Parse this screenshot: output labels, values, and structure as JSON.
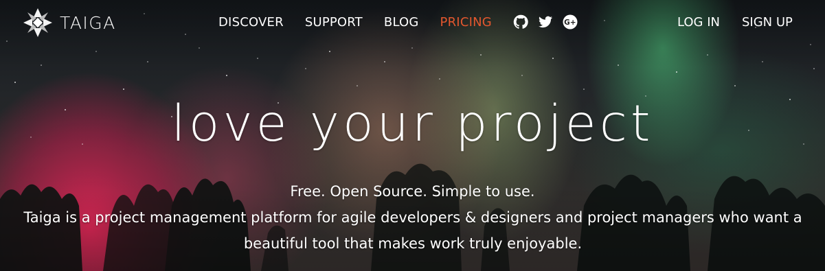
{
  "brand": {
    "name": "TAIGA",
    "logo_icon": "taiga-star-icon"
  },
  "nav": {
    "items": [
      {
        "label": "DISCOVER"
      },
      {
        "label": "SUPPORT"
      },
      {
        "label": "BLOG"
      },
      {
        "label": "PRICING",
        "highlight_color": "#e4572e"
      }
    ],
    "social": [
      {
        "icon": "github-icon"
      },
      {
        "icon": "twitter-icon"
      },
      {
        "icon": "google-plus-icon"
      }
    ],
    "auth": {
      "login": "LOG IN",
      "signup": "SIGN UP"
    }
  },
  "hero": {
    "headline": "love your project",
    "tagline": "Free. Open Source. Simple to use.",
    "description": "Taiga is a project management platform for agile developers & designers and project managers who want a beautiful tool that makes work truly enjoyable."
  },
  "colors": {
    "accent": "#e4572e",
    "text": "#ffffff"
  }
}
